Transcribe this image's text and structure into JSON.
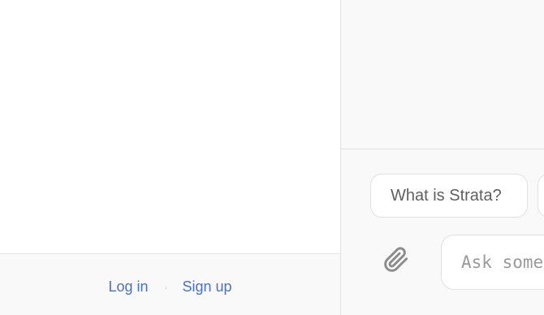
{
  "auth": {
    "login_label": "Log in",
    "separator": "·",
    "signup_label": "Sign up",
    "link_color": "#4a6fd1"
  },
  "chat": {
    "suggestions": [
      {
        "label": "What is Strata?"
      },
      {
        "label": ""
      }
    ],
    "attach_icon": "paperclip-icon",
    "input": {
      "placeholder": "Ask something...",
      "value": ""
    }
  }
}
